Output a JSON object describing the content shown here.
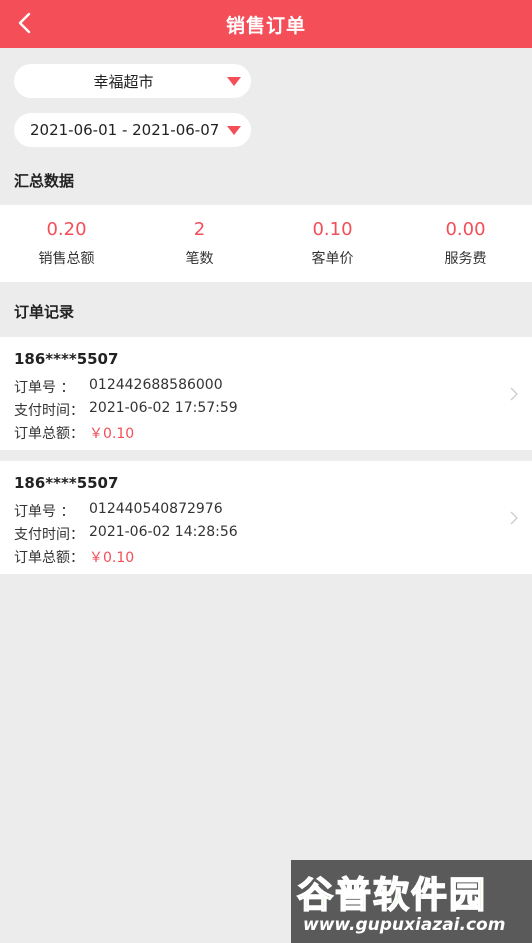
{
  "header": {
    "title": "销售订单",
    "back_icon": "chevron-left-icon"
  },
  "filters": {
    "store": "幸福超市",
    "date_range": "2021-06-01 - 2021-06-07",
    "caret_color": "#f44e59"
  },
  "summary": {
    "title": "汇总数据",
    "items": [
      {
        "value": "0.20",
        "label": "销售总额"
      },
      {
        "value": "2",
        "label": "笔数"
      },
      {
        "value": "0.10",
        "label": "客单价"
      },
      {
        "value": "0.00",
        "label": "服务费"
      }
    ]
  },
  "orders": {
    "title": "订单记录",
    "items": [
      {
        "phone": "186****5507",
        "order_no_label": "订单号   ：",
        "order_no": "012442688586000",
        "pay_time_label": "支付时间：",
        "pay_time": "2021-06-02 17:57:59",
        "total_label": "订单总额：",
        "total": "￥0.10"
      },
      {
        "phone": "186****5507",
        "order_no_label": "订单号   ：",
        "order_no": "012440540872976",
        "pay_time_label": "支付时间：",
        "pay_time": "2021-06-02 14:28:56",
        "total_label": "订单总额：",
        "total": "￥0.10"
      }
    ]
  },
  "watermark": {
    "name": "谷普软件园",
    "url": "www.gupuxiazai.com"
  },
  "colors": {
    "accent": "#f44e59",
    "background": "#ececec"
  }
}
